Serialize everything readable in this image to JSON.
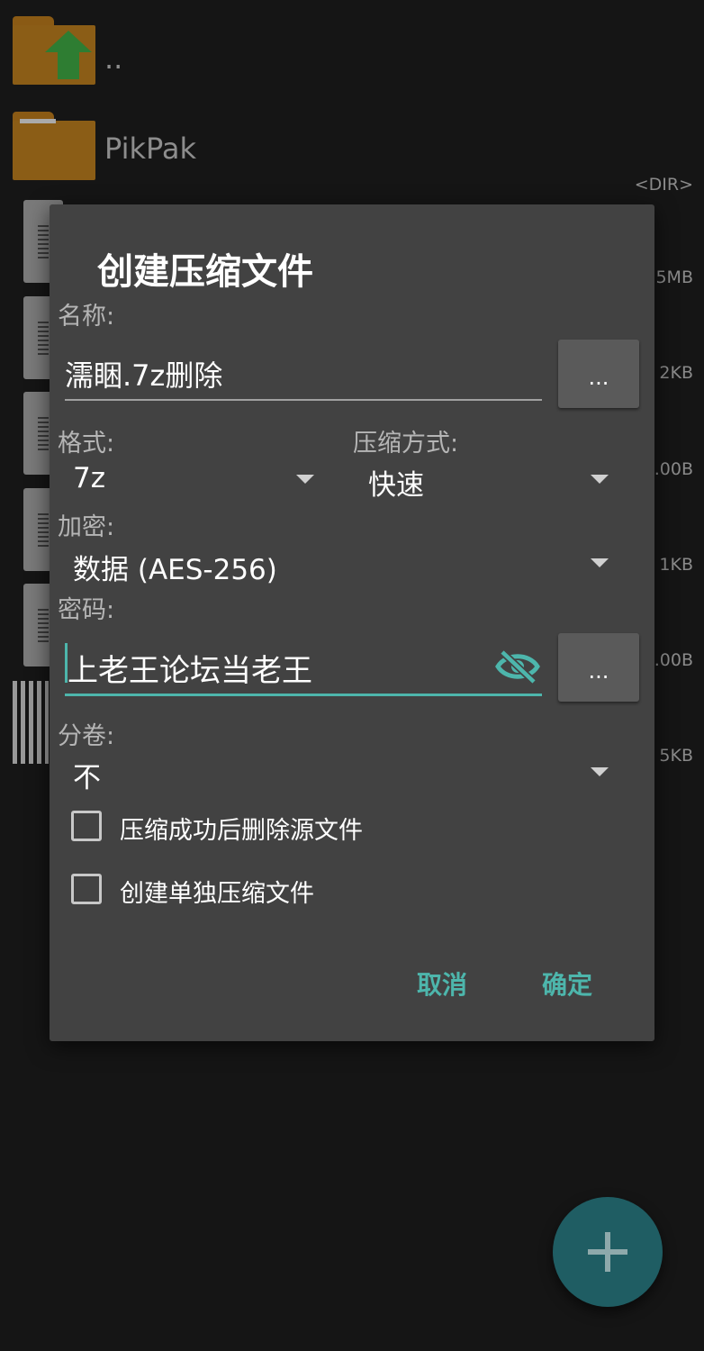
{
  "background_list": {
    "items": [
      {
        "name": "..",
        "icon": "folder-up-icon"
      },
      {
        "name": "PikPak",
        "icon": "folder-icon",
        "meta": "<DIR>"
      }
    ],
    "right_meta": [
      "5MB",
      "2KB",
      ".00B",
      "1KB",
      ".00B",
      "5KB"
    ]
  },
  "dialog": {
    "title": "创建压缩文件",
    "name_label": "名称:",
    "name_value": "濡睏.7z删除",
    "more_label": "...",
    "format_label": "格式:",
    "format_value": "7z",
    "method_label": "压缩方式:",
    "method_value": "快速",
    "encryption_label": "加密:",
    "encryption_value": "数据 (AES-256)",
    "password_label": "密码:",
    "password_value": "上老王论坛当老王",
    "volume_label": "分卷:",
    "volume_value": "不",
    "checkbox_delete_label": "压缩成功后删除源文件",
    "checkbox_delete_checked": false,
    "checkbox_separate_label": "创建单独压缩文件",
    "checkbox_separate_checked": false,
    "cancel_label": "取消",
    "ok_label": "确定"
  },
  "colors": {
    "accent": "#4db6ac",
    "dialog_bg": "#424242",
    "screen_bg": "#151515",
    "folder": "#8b5d16"
  }
}
